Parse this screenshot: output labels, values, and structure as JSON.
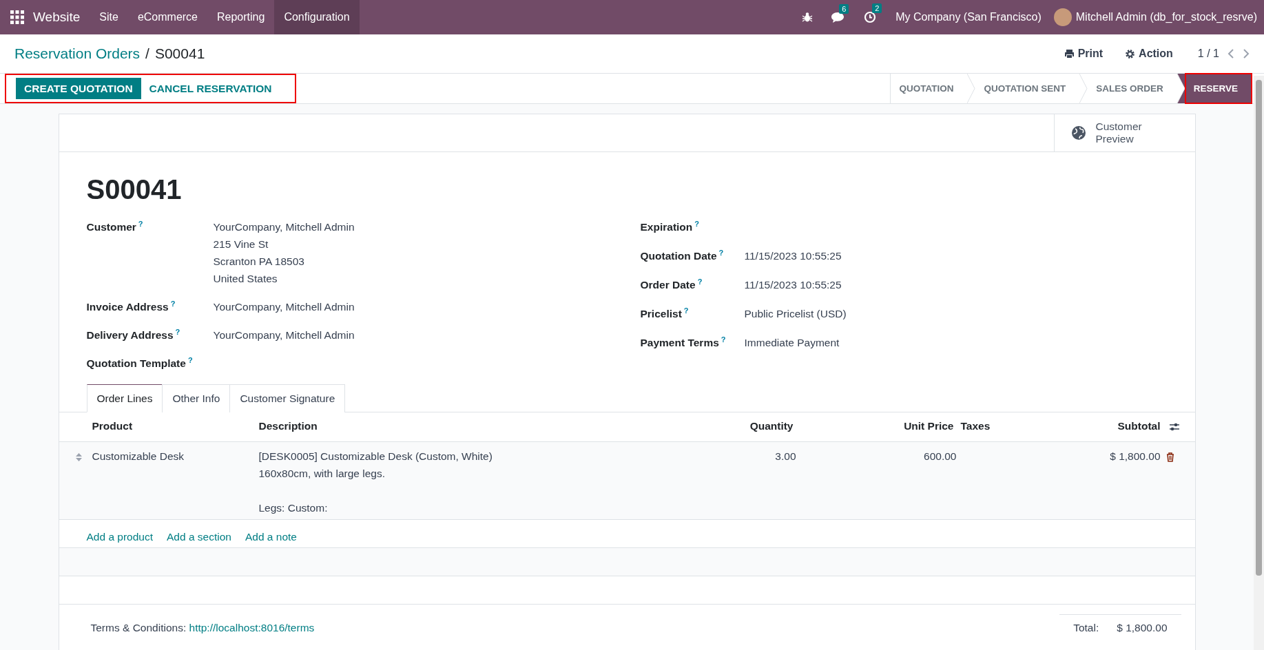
{
  "navbar": {
    "app_name": "Website",
    "menus": [
      {
        "label": "Site",
        "selected": false
      },
      {
        "label": "eCommerce",
        "selected": false
      },
      {
        "label": "Reporting",
        "selected": false
      },
      {
        "label": "Configuration",
        "selected": true
      }
    ],
    "notifications": [
      {
        "kind": "chat",
        "count": "6"
      },
      {
        "kind": "activity",
        "count": "2"
      }
    ],
    "company": "My Company (San Francisco)",
    "user": "Mitchell Admin (db_for_stock_resrve)"
  },
  "breadcrumb": {
    "parent": "Reservation Orders",
    "separator": "/",
    "current": "S00041"
  },
  "toolbar": {
    "print": "Print",
    "action": "Action",
    "pager": "1 / 1"
  },
  "actions": {
    "highlighted": true,
    "buttons": [
      {
        "label": "CREATE QUOTATION",
        "primary": true
      },
      {
        "label": "CANCEL RESERVATION",
        "primary": false
      }
    ]
  },
  "stages": [
    {
      "label": "QUOTATION",
      "selected": false,
      "highlighted": false
    },
    {
      "label": "QUOTATION SENT",
      "selected": false,
      "highlighted": false
    },
    {
      "label": "SALES ORDER",
      "selected": false,
      "highlighted": false
    },
    {
      "label": "RESERVE",
      "selected": true,
      "highlighted": true
    }
  ],
  "sheet": {
    "smart_button": "Customer Preview",
    "title": "S00041",
    "left_fields": [
      {
        "label": "Customer",
        "hint": "?",
        "lines": [
          "YourCompany, Mitchell Admin",
          "215 Vine St",
          "Scranton PA 18503",
          "United States"
        ]
      },
      {
        "label": "Invoice Address",
        "hint": "?",
        "lines": [
          "YourCompany, Mitchell Admin"
        ]
      },
      {
        "label": "Delivery Address",
        "hint": "?",
        "lines": [
          "YourCompany, Mitchell Admin"
        ]
      },
      {
        "label": "Quotation Template",
        "hint": "?"
      }
    ],
    "right_fields": [
      {
        "label": "Expiration",
        "hint": "?"
      },
      {
        "label": "Quotation Date",
        "hint": "?",
        "lines": [
          "11/15/2023 10:55:25"
        ]
      },
      {
        "label": "Order Date",
        "hint": "?",
        "lines": [
          "11/15/2023 10:55:25"
        ]
      },
      {
        "label": "Pricelist",
        "hint": "?",
        "lines": [
          "Public Pricelist (USD)"
        ]
      },
      {
        "label": "Payment Terms",
        "hint": "?",
        "lines": [
          "Immediate Payment"
        ]
      }
    ],
    "tabs": [
      {
        "label": "Order Lines",
        "selected": true
      },
      {
        "label": "Other Info",
        "selected": false
      },
      {
        "label": "Customer Signature",
        "selected": false
      }
    ],
    "table": {
      "columns": [
        "Product",
        "Description",
        "Quantity",
        "Unit Price",
        "Taxes",
        "Subtotal"
      ],
      "rows": [
        {
          "product": "Customizable Desk",
          "description": [
            [
              "[DESK0005] Customizable Desk (Custom, White)",
              "160x80cm, with large legs."
            ],
            [
              "Legs: Custom:"
            ]
          ],
          "quantity": "3.00",
          "unit_price": "600.00",
          "subtotal": "$ 1,800.00"
        }
      ],
      "add_links": [
        "Add a product",
        "Add a section",
        "Add a note"
      ]
    },
    "terms": {
      "label": "Terms & Conditions:",
      "link": "http://localhost:8016/terms"
    },
    "total": {
      "label": "Total:",
      "value": "$ 1,800.00"
    }
  }
}
